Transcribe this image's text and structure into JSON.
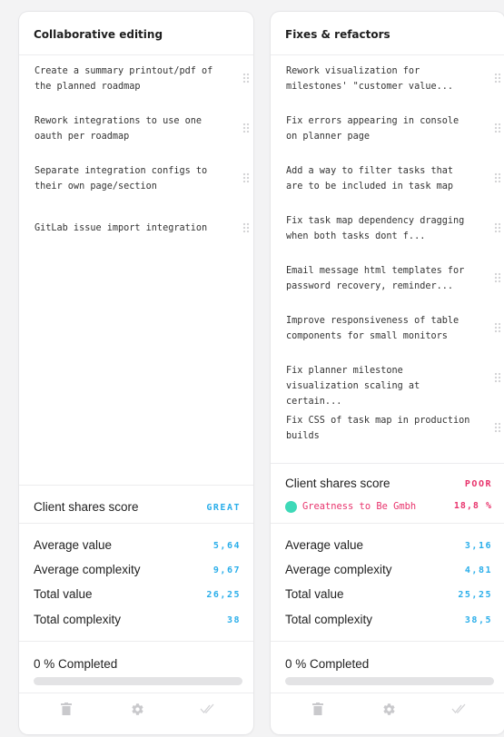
{
  "columns": [
    {
      "title": "Collaborative editing",
      "tasks": [
        "Create a summary printout/pdf of the planned roadmap",
        "Rework integrations to use one oauth per roadmap",
        "Separate integration configs to their own page/section",
        "GitLab issue import integration"
      ],
      "score_label": "Client shares score",
      "score_value": "GREAT",
      "score_color": "#2aaeea",
      "metrics": [
        {
          "label": "Average value",
          "value": "5,64"
        },
        {
          "label": "Average complexity",
          "value": "9,67"
        },
        {
          "label": "Total value",
          "value": "26,25"
        },
        {
          "label": "Total complexity",
          "value": "38"
        }
      ],
      "progress_label": "0 % Completed",
      "progress_percent": 0,
      "footer_icons": [
        "trash-icon",
        "gear-icon",
        "double-check-icon"
      ]
    },
    {
      "title": "Fixes & refactors",
      "tasks": [
        "Rework visualization for milestones' \"customer value...",
        "Fix errors appearing in console on planner page",
        "Add a way to filter tasks that are to be included in task map",
        "Fix task map dependency dragging when both tasks dont f...",
        "Email message html templates for password recovery, reminder...",
        "Improve responsiveness of table components for small monitors",
        "Fix planner milestone visualization scaling at certain...",
        "Fix CSS of task map in production builds"
      ],
      "score_label": "Client shares score",
      "score_value": "POOR",
      "score_color": "#e8336c",
      "client": {
        "name": "Greatness to Be Gmbh",
        "percent": "18,8 %",
        "dot_color": "#3ed9b8"
      },
      "metrics": [
        {
          "label": "Average value",
          "value": "3,16"
        },
        {
          "label": "Average complexity",
          "value": "4,81"
        },
        {
          "label": "Total value",
          "value": "25,25"
        },
        {
          "label": "Total complexity",
          "value": "38,5"
        }
      ],
      "progress_label": "0 % Completed",
      "progress_percent": 0,
      "footer_icons": [
        "trash-icon",
        "gear-icon",
        "double-check-icon"
      ]
    }
  ],
  "metric_color": "#2aaeea"
}
